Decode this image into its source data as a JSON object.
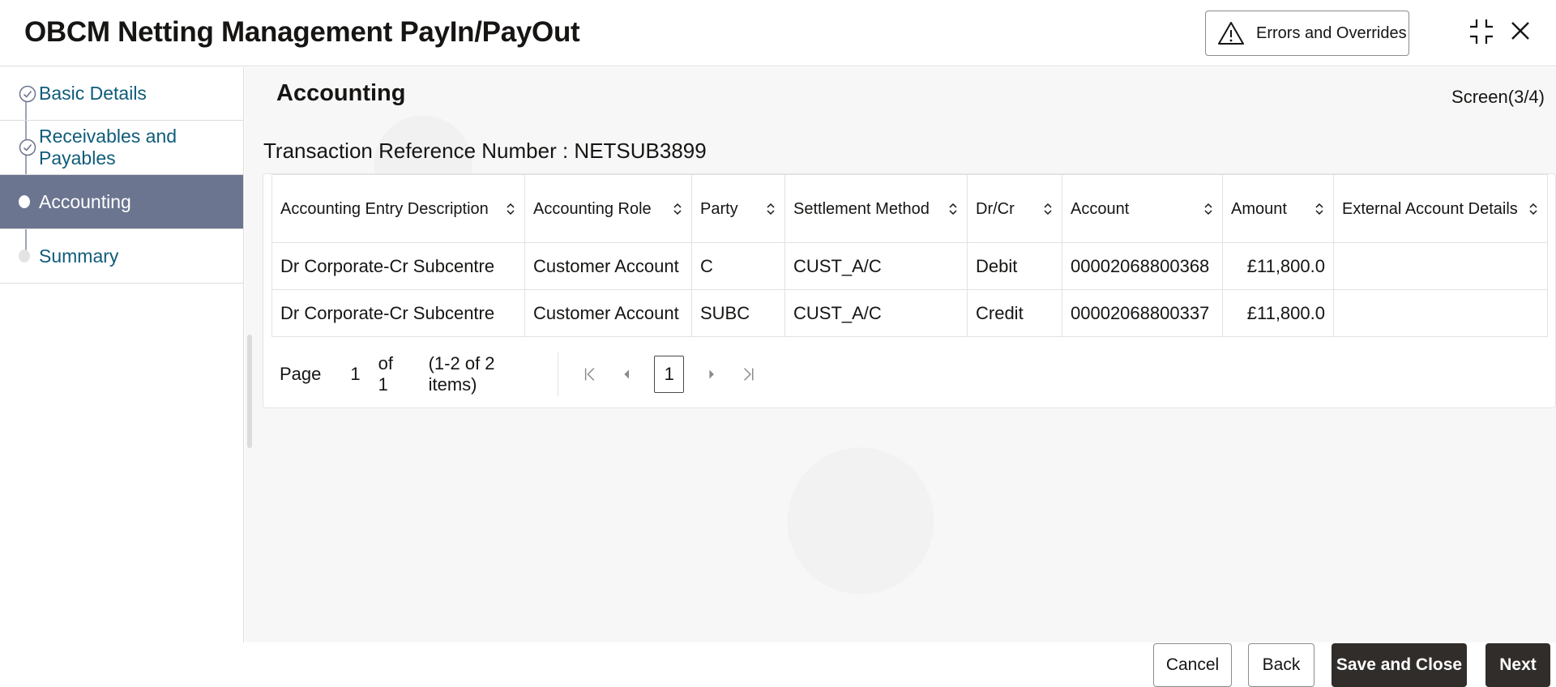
{
  "header": {
    "title": "OBCM Netting Management PayIn/PayOut",
    "errors_button_label": "Errors and Overrides",
    "icons": [
      "warning-icon",
      "minimize-icon",
      "close-icon"
    ]
  },
  "sidebar": {
    "steps": [
      {
        "label": "Basic Details",
        "state": "completed"
      },
      {
        "label": "Receivables and Payables",
        "state": "completed"
      },
      {
        "label": "Accounting",
        "state": "active"
      },
      {
        "label": "Summary",
        "state": "pending"
      }
    ]
  },
  "main": {
    "section_title": "Accounting",
    "screen_indicator": "Screen(3/4)",
    "txn_ref": "Transaction Reference Number : NETSUB3899"
  },
  "table": {
    "columns": [
      "Accounting Entry Description",
      "Accounting Role",
      "Party",
      "Settlement Method",
      "Dr/Cr",
      "Account",
      "Amount",
      "External Account Details"
    ],
    "rows": [
      [
        "Dr Corporate-Cr Subcentre",
        "Customer Account",
        "C",
        "CUST_A/C",
        "Debit",
        "00002068800368",
        "£11,800.0",
        ""
      ],
      [
        "Dr Corporate-Cr Subcentre",
        "Customer Account",
        "SUBC",
        "CUST_A/C",
        "Credit",
        "00002068800337",
        "£11,800.0",
        ""
      ]
    ]
  },
  "pagination": {
    "page_label": "Page",
    "current_page": "1",
    "of_label": "of 1",
    "items_label": "(1-2 of 2 items)",
    "page_button": "1"
  },
  "footer": {
    "cancel": "Cancel",
    "back": "Back",
    "save_close": "Save and Close",
    "next": "Next"
  },
  "colors": {
    "active_step_bg": "#6b7590",
    "link_text": "#0f5c7a",
    "primary_button": "#312d2a"
  }
}
